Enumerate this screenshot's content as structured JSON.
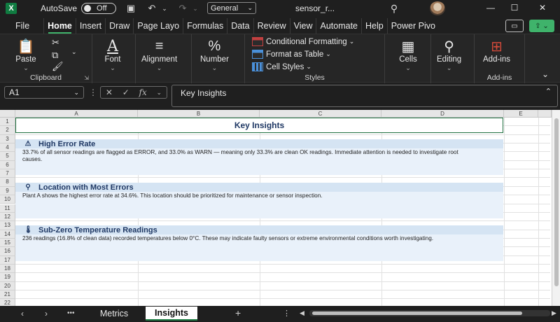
{
  "titlebar": {
    "app_icon": "X",
    "autosave_label": "AutoSave",
    "autosave_state": "Off",
    "number_format": "General",
    "doc_title": "sensor_r..."
  },
  "menu": [
    "File",
    "Home",
    "Insert",
    "Draw",
    "Page Layo",
    "Formulas",
    "Data",
    "Review",
    "View",
    "Automate",
    "Help",
    "Power Pivo"
  ],
  "ribbon": {
    "clipboard": {
      "paste": "Paste",
      "label": "Clipboard"
    },
    "font": "Font",
    "alignment": "Alignment",
    "number": "Number",
    "styles": {
      "conditional": "Conditional Formatting",
      "format_table": "Format as Table",
      "cell_styles": "Cell Styles",
      "label": "Styles"
    },
    "cells": "Cells",
    "editing": "Editing",
    "addins": "Add-ins",
    "addins_label": "Add-ins"
  },
  "formula_bar": {
    "name_box": "A1",
    "fx": "fx",
    "content": "Key Insights"
  },
  "columns": [
    "A",
    "B",
    "C",
    "D",
    "E"
  ],
  "rows": [
    "1",
    "2",
    "3",
    "4",
    "5",
    "6",
    "7",
    "8",
    "9",
    "10",
    "11",
    "12",
    "13",
    "14",
    "15",
    "16",
    "17",
    "18",
    "19",
    "20",
    "21",
    "22"
  ],
  "sheet": {
    "title": "Key Insights",
    "sections": [
      {
        "icon": "warning-icon",
        "glyph": "⚠",
        "heading": "High Error Rate",
        "text": "33.7% of all sensor readings are flagged as ERROR, and 33.0% as WARN — meaning only 33.3% are clean OK readings. Immediate attention is needed to investigate root causes."
      },
      {
        "icon": "location-pin-icon",
        "glyph": "⚲",
        "heading": "Location with Most Errors",
        "text": "Plant A shows the highest error rate at 34.6%. This location should be prioritized for maintenance or sensor inspection."
      },
      {
        "icon": "thermometer-icon",
        "glyph": "🌡",
        "heading": "Sub-Zero Temperature Readings",
        "text": "236 readings (16.8% of clean data) recorded temperatures below 0°C. These may indicate faulty sensors or extreme environmental conditions worth investigating."
      }
    ]
  },
  "tabs": {
    "items": [
      "Metrics",
      "Insights"
    ],
    "active": "Insights",
    "more": "•••",
    "add": "+"
  }
}
